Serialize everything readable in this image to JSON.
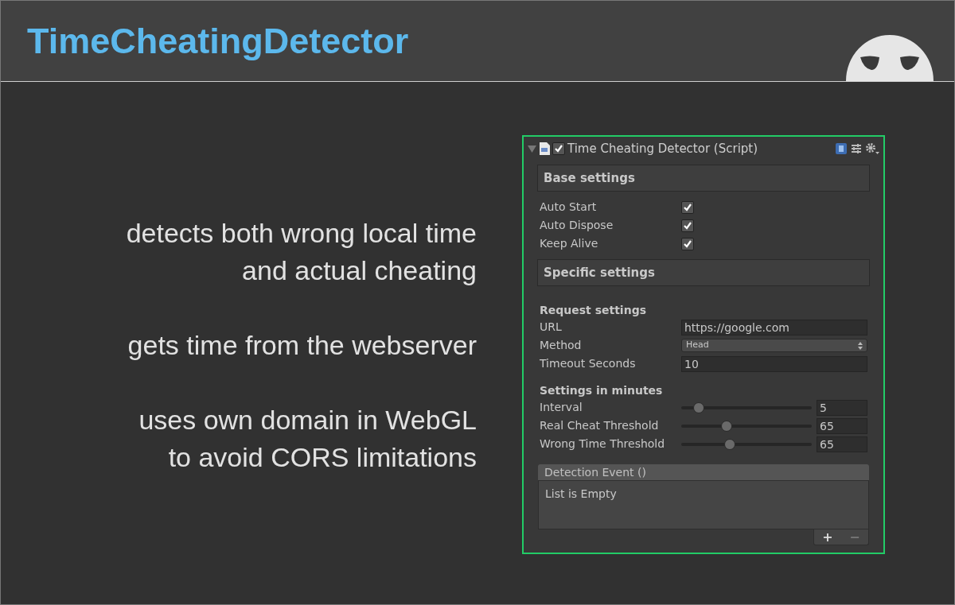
{
  "header": {
    "title": "TimeCheatingDetector"
  },
  "features": [
    {
      "lines": [
        "detects both wrong local time",
        "and actual cheating"
      ]
    },
    {
      "lines": [
        "gets time from the webserver"
      ]
    },
    {
      "lines": [
        "uses own domain in WebGL",
        "to avoid CORS limitations"
      ]
    }
  ],
  "inspector": {
    "title": "Time Cheating Detector (Script)",
    "expanded": true,
    "enabled": true,
    "rows": [
      {
        "kind": "section",
        "label": "Base settings"
      },
      {
        "kind": "toggle",
        "label": "Auto Start",
        "checked": true
      },
      {
        "kind": "toggle",
        "label": "Auto Dispose",
        "checked": true
      },
      {
        "kind": "toggle",
        "label": "Keep Alive",
        "checked": true
      },
      {
        "kind": "section",
        "label": "Specific settings"
      },
      {
        "kind": "heading",
        "label": "Request settings"
      },
      {
        "kind": "text",
        "label": "URL",
        "value": "https://google.com"
      },
      {
        "kind": "dropdown",
        "label": "Method",
        "value": "Head"
      },
      {
        "kind": "text",
        "label": "Timeout Seconds",
        "value": "10"
      },
      {
        "kind": "heading",
        "label": "Settings in minutes"
      },
      {
        "kind": "slider",
        "label": "Interval",
        "level": 0.1,
        "value": "5"
      },
      {
        "kind": "slider",
        "label": "Real Cheat Threshold",
        "level": 0.33,
        "value": "65"
      },
      {
        "kind": "slider",
        "label": "Wrong Time Threshold",
        "level": 0.36,
        "value": "65"
      },
      {
        "kind": "event",
        "label": "Detection Event ()",
        "empty_text": "List is Empty",
        "add": "+",
        "remove": "−"
      }
    ]
  }
}
